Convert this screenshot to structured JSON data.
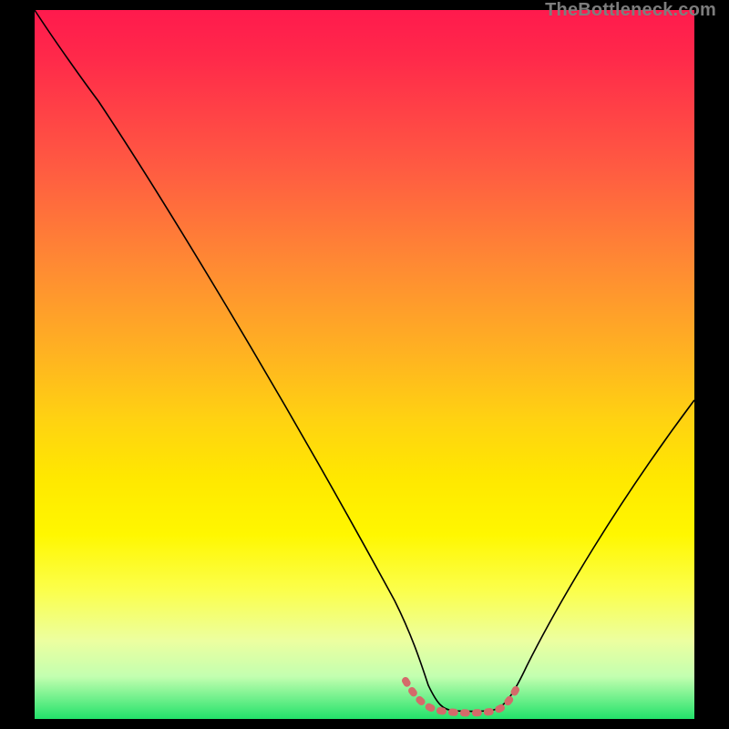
{
  "watermark": "TheBottleneck.com",
  "chart_data": {
    "type": "line",
    "title": "",
    "xlabel": "",
    "ylabel": "",
    "xlim": [
      0,
      100
    ],
    "ylim": [
      0,
      100
    ],
    "grid": false,
    "series": [
      {
        "name": "bottleneck-curve",
        "x": [
          0,
          4,
          10,
          20,
          30,
          40,
          50,
          56,
          58,
          60,
          63,
          66,
          68,
          70,
          74,
          80,
          88,
          96,
          100
        ],
        "values": [
          99,
          95,
          88,
          75,
          62,
          48,
          31,
          16,
          10,
          5,
          2,
          1.5,
          1.5,
          2,
          5,
          14,
          29,
          46,
          55
        ]
      },
      {
        "name": "optimal-range-marker",
        "x": [
          56,
          58,
          60,
          62,
          64,
          66,
          68,
          70,
          72
        ],
        "values": [
          4.5,
          3.2,
          2.3,
          1.9,
          1.8,
          1.8,
          2.0,
          2.6,
          3.8
        ]
      }
    ],
    "colors": {
      "curve": "#000000",
      "marker": "#d46a6a",
      "gradient_top": "#ff1a4d",
      "gradient_mid": "#ffe800",
      "gradient_bottom": "#22e26a"
    }
  }
}
